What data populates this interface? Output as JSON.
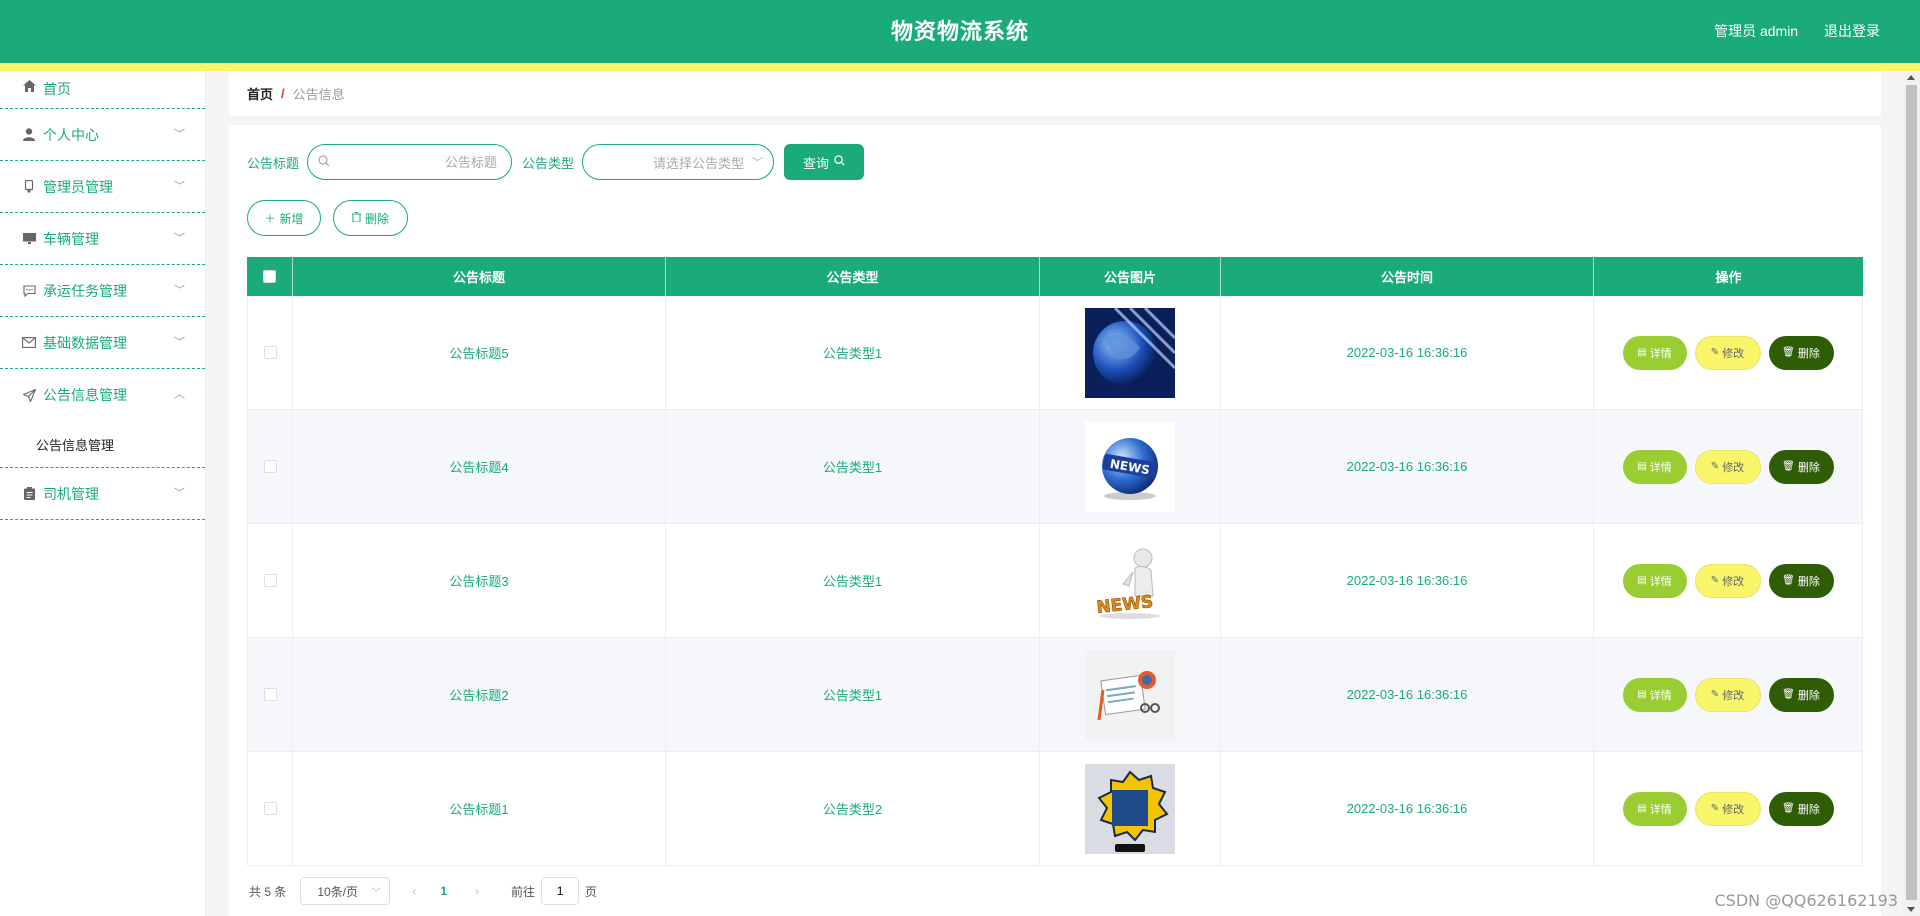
{
  "header": {
    "title": "物资物流系统",
    "user": "管理员 admin",
    "logout": "退出登录"
  },
  "sidebar": {
    "items": [
      {
        "label": "首页",
        "icon": "home-icon"
      },
      {
        "label": "个人中心",
        "icon": "user-icon"
      },
      {
        "label": "管理员管理",
        "icon": "admin-icon"
      },
      {
        "label": "车辆管理",
        "icon": "monitor-icon"
      },
      {
        "label": "承运任务管理",
        "icon": "chat-icon"
      },
      {
        "label": "基础数据管理",
        "icon": "mail-icon"
      },
      {
        "label": "公告信息管理",
        "icon": "send-icon"
      },
      {
        "label": "司机管理",
        "icon": "clipboard-icon"
      }
    ],
    "submenu": "公告信息管理"
  },
  "breadcrumb": {
    "home": "首页",
    "separator": "/",
    "current": "公告信息"
  },
  "search": {
    "title_label": "公告标题",
    "title_placeholder": "公告标题",
    "type_label": "公告类型",
    "type_placeholder": "请选择公告类型",
    "query_button": "查询"
  },
  "actions": {
    "add": "新增",
    "delete": "删除"
  },
  "table": {
    "headers": [
      "公告标题",
      "公告类型",
      "公告图片",
      "公告时间",
      "操作"
    ],
    "rows": [
      {
        "title": "公告标题5",
        "type": "公告类型1",
        "image": "globe-network-image",
        "time": "2022-03-16 16:36:16"
      },
      {
        "title": "公告标题4",
        "type": "公告类型1",
        "image": "news-globe-image",
        "time": "2022-03-16 16:36:16"
      },
      {
        "title": "公告标题3",
        "type": "公告类型1",
        "image": "news-figure-image",
        "time": "2022-03-16 16:36:16"
      },
      {
        "title": "公告标题2",
        "type": "公告类型1",
        "image": "newspaper-image",
        "time": "2022-03-16 16:36:16"
      },
      {
        "title": "公告标题1",
        "type": "公告类型2",
        "image": "breaking-news-image",
        "time": "2022-03-16 16:36:16"
      }
    ],
    "row_actions": {
      "detail": "详情",
      "edit": "修改",
      "remove": "删除"
    }
  },
  "pagination": {
    "total": "共 5 条",
    "page_size": "10条/页",
    "current_page": "1",
    "goto_label": "前往",
    "goto_value": "1",
    "page_suffix": "页"
  },
  "watermark": "CSDN @QQ626162193",
  "colors": {
    "primary": "#1aab78",
    "accent_yellow": "#f8f56a",
    "detail_green": "#9acd32",
    "delete_dark_green": "#2e5d06"
  }
}
